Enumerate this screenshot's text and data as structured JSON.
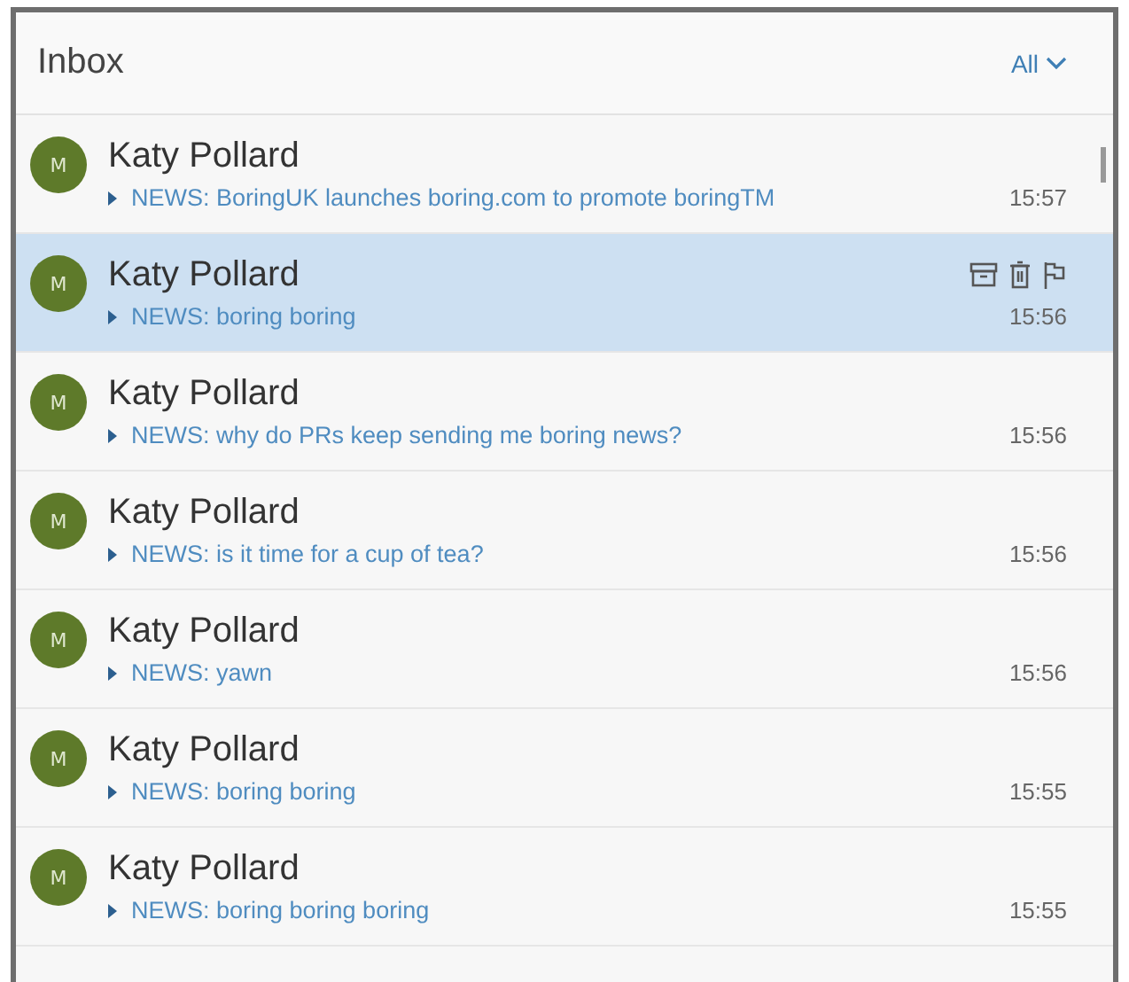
{
  "header": {
    "title": "Inbox",
    "filter": "All"
  },
  "messages": [
    {
      "avatar": "M",
      "sender": "Katy Pollard",
      "subject": "NEWS: BoringUK launches boring.com to promote boringTM",
      "time": "15:57",
      "selected": false
    },
    {
      "avatar": "M",
      "sender": "Katy Pollard",
      "subject": "NEWS: boring boring",
      "time": "15:56",
      "selected": true
    },
    {
      "avatar": "M",
      "sender": "Katy Pollard",
      "subject": "NEWS: why do PRs keep sending me boring news?",
      "time": "15:56",
      "selected": false
    },
    {
      "avatar": "M",
      "sender": "Katy Pollard",
      "subject": "NEWS: is it time for a cup of tea?",
      "time": "15:56",
      "selected": false
    },
    {
      "avatar": "M",
      "sender": "Katy Pollard",
      "subject": "NEWS: yawn",
      "time": "15:56",
      "selected": false
    },
    {
      "avatar": "M",
      "sender": "Katy Pollard",
      "subject": "NEWS: boring boring",
      "time": "15:55",
      "selected": false
    },
    {
      "avatar": "M",
      "sender": "Katy Pollard",
      "subject": "NEWS: boring boring boring",
      "time": "15:55",
      "selected": false
    }
  ]
}
